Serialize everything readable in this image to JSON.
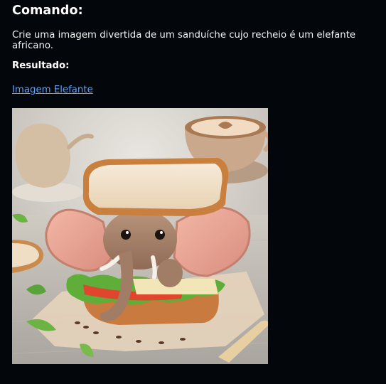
{
  "command": {
    "heading": "Comando:",
    "prompt_text": "Crie uma imagem divertida de um sanduíche cujo recheio é um elefante africano."
  },
  "result": {
    "label": "Resultado:",
    "link_text": "Imagem Elefante",
    "image_subject": "elephant-sandwich"
  },
  "colors": {
    "background": "#03060b",
    "text": "#ffffff",
    "link": "#5aa3ff"
  }
}
